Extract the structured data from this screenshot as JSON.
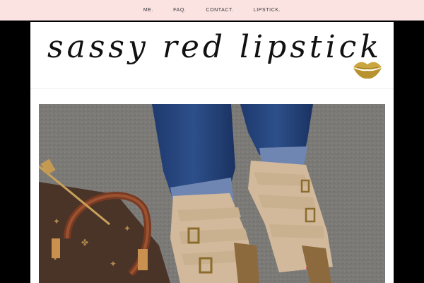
{
  "nav": {
    "items": [
      {
        "label": "ME."
      },
      {
        "label": "FAQ."
      },
      {
        "label": "CONTACT."
      },
      {
        "label": "LIPSTICK."
      }
    ]
  },
  "header": {
    "logo_text": "sassy red lipstick",
    "logo_icon": "gold-lips-icon"
  },
  "colors": {
    "nav_background": "#fbe3e2",
    "page_background": "#ffffff",
    "outer_background": "#000000",
    "lips_gold": "#c9a640"
  },
  "hero": {
    "image": "feet-in-tan-buckle-sandals-with-monogram-bag"
  }
}
